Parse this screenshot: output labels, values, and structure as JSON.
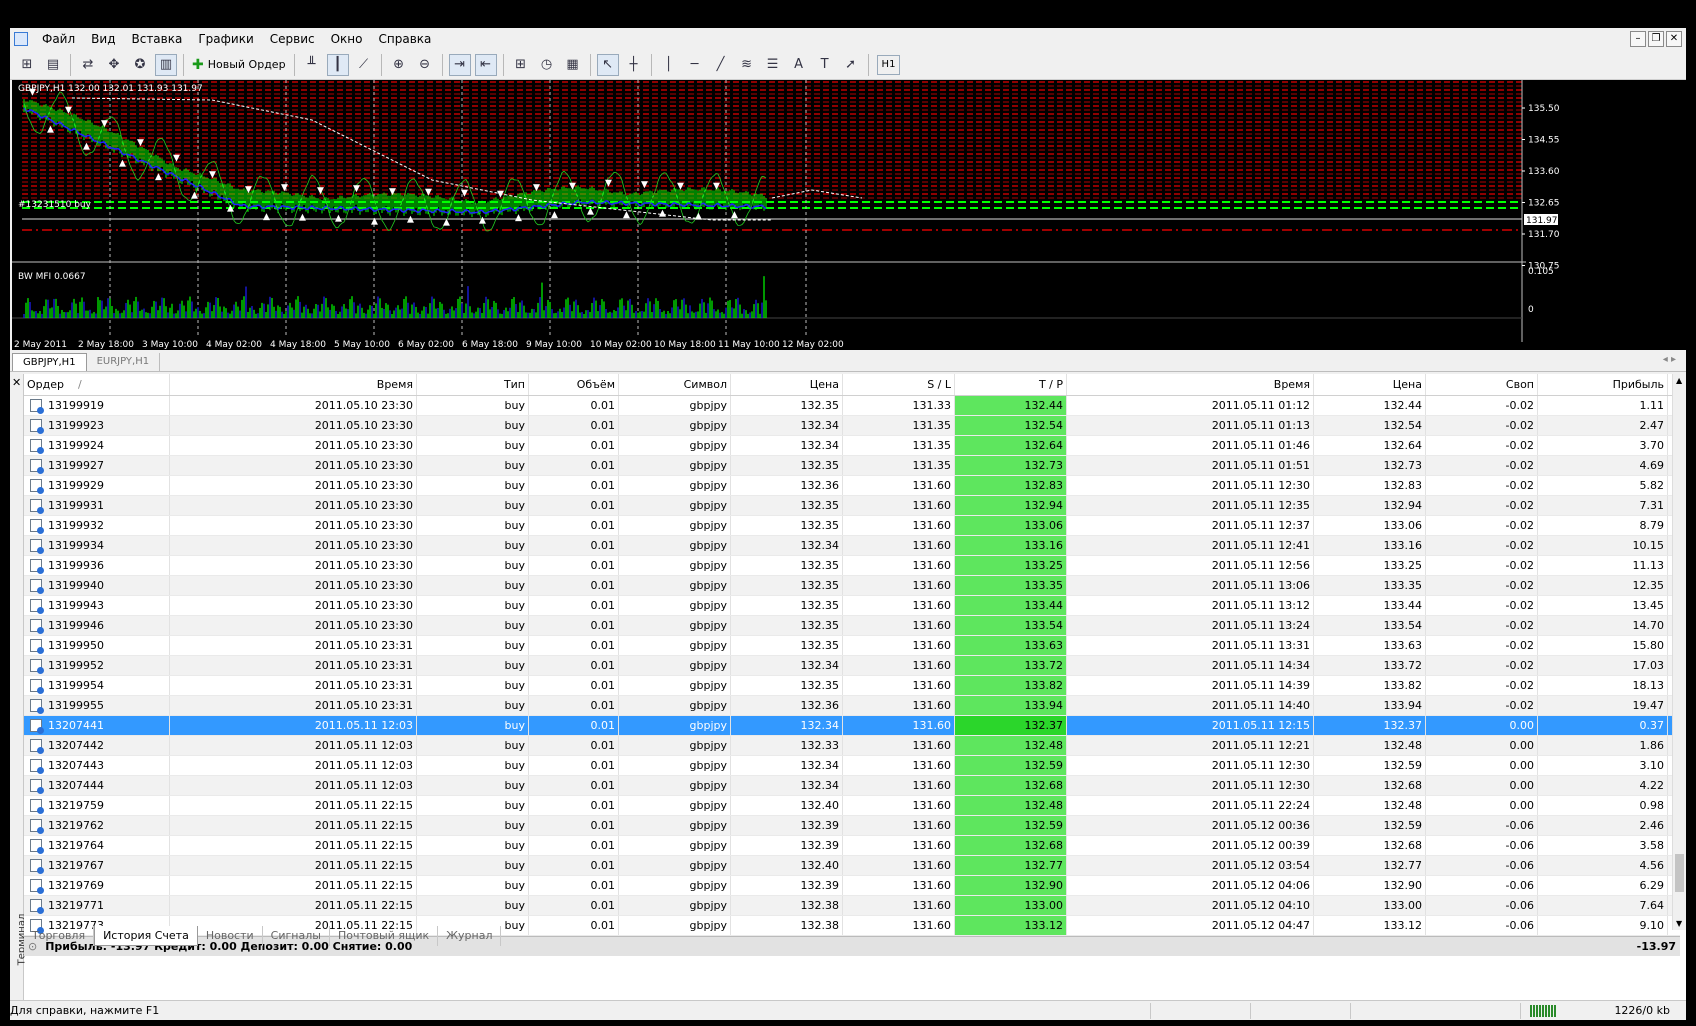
{
  "menu": [
    "Файл",
    "Вид",
    "Вставка",
    "Графики",
    "Сервис",
    "Окно",
    "Справка"
  ],
  "toolbar": {
    "new_order_label": "Новый Ордер",
    "timeframe": "H1"
  },
  "chart": {
    "symbol_info": "GBPJPY,H1  132.00 132.01 131.93 131.97",
    "order_label": "#13231510 buy",
    "current_price": "131.97",
    "price_ticks": [
      "135.50",
      "134.55",
      "133.60",
      "132.65",
      "131.70",
      "130.75"
    ],
    "indicator_label": "BW MFI 0.0667",
    "indicator_ticks": [
      "0.105",
      "0"
    ],
    "time_labels": [
      "2 May 2011",
      "2 May 18:00",
      "3 May 10:00",
      "4 May 02:00",
      "4 May 18:00",
      "5 May 10:00",
      "6 May 02:00",
      "6 May 18:00",
      "9 May 10:00",
      "10 May 02:00",
      "10 May 18:00",
      "11 May 10:00",
      "12 May 02:00"
    ],
    "colors": {
      "bg": "#000000",
      "up": "#00ff00",
      "grid": "#ff0000",
      "ma": "#2020ff",
      "trend": "#ffffff"
    }
  },
  "chart_tabs": [
    "GBPJPY,H1",
    "EURJPY,H1"
  ],
  "table": {
    "headers": {
      "order": "Ордер",
      "time": "Время",
      "type": "Тип",
      "volume": "Объём",
      "symbol": "Символ",
      "price": "Цена",
      "sl": "S / L",
      "tp": "T / P",
      "close_time": "Время",
      "close_price": "Цена",
      "swap": "Своп",
      "profit": "Прибыль"
    },
    "sort_mark": "/",
    "rows": [
      [
        "13199919",
        "2011.05.10 23:30",
        "buy",
        "0.01",
        "gbpjpy",
        "132.35",
        "131.33",
        "132.44",
        "2011.05.11 01:12",
        "132.44",
        "-0.02",
        "1.11"
      ],
      [
        "13199923",
        "2011.05.10 23:30",
        "buy",
        "0.01",
        "gbpjpy",
        "132.34",
        "131.35",
        "132.54",
        "2011.05.11 01:13",
        "132.54",
        "-0.02",
        "2.47"
      ],
      [
        "13199924",
        "2011.05.10 23:30",
        "buy",
        "0.01",
        "gbpjpy",
        "132.34",
        "131.35",
        "132.64",
        "2011.05.11 01:46",
        "132.64",
        "-0.02",
        "3.70"
      ],
      [
        "13199927",
        "2011.05.10 23:30",
        "buy",
        "0.01",
        "gbpjpy",
        "132.35",
        "131.35",
        "132.73",
        "2011.05.11 01:51",
        "132.73",
        "-0.02",
        "4.69"
      ],
      [
        "13199929",
        "2011.05.10 23:30",
        "buy",
        "0.01",
        "gbpjpy",
        "132.36",
        "131.60",
        "132.83",
        "2011.05.11 12:30",
        "132.83",
        "-0.02",
        "5.82"
      ],
      [
        "13199931",
        "2011.05.10 23:30",
        "buy",
        "0.01",
        "gbpjpy",
        "132.35",
        "131.60",
        "132.94",
        "2011.05.11 12:35",
        "132.94",
        "-0.02",
        "7.31"
      ],
      [
        "13199932",
        "2011.05.10 23:30",
        "buy",
        "0.01",
        "gbpjpy",
        "132.35",
        "131.60",
        "133.06",
        "2011.05.11 12:37",
        "133.06",
        "-0.02",
        "8.79"
      ],
      [
        "13199934",
        "2011.05.10 23:30",
        "buy",
        "0.01",
        "gbpjpy",
        "132.34",
        "131.60",
        "133.16",
        "2011.05.11 12:41",
        "133.16",
        "-0.02",
        "10.15"
      ],
      [
        "13199936",
        "2011.05.10 23:30",
        "buy",
        "0.01",
        "gbpjpy",
        "132.35",
        "131.60",
        "133.25",
        "2011.05.11 12:56",
        "133.25",
        "-0.02",
        "11.13"
      ],
      [
        "13199940",
        "2011.05.10 23:30",
        "buy",
        "0.01",
        "gbpjpy",
        "132.35",
        "131.60",
        "133.35",
        "2011.05.11 13:06",
        "133.35",
        "-0.02",
        "12.35"
      ],
      [
        "13199943",
        "2011.05.10 23:30",
        "buy",
        "0.01",
        "gbpjpy",
        "132.35",
        "131.60",
        "133.44",
        "2011.05.11 13:12",
        "133.44",
        "-0.02",
        "13.45"
      ],
      [
        "13199946",
        "2011.05.10 23:30",
        "buy",
        "0.01",
        "gbpjpy",
        "132.35",
        "131.60",
        "133.54",
        "2011.05.11 13:24",
        "133.54",
        "-0.02",
        "14.70"
      ],
      [
        "13199950",
        "2011.05.10 23:31",
        "buy",
        "0.01",
        "gbpjpy",
        "132.35",
        "131.60",
        "133.63",
        "2011.05.11 13:31",
        "133.63",
        "-0.02",
        "15.80"
      ],
      [
        "13199952",
        "2011.05.10 23:31",
        "buy",
        "0.01",
        "gbpjpy",
        "132.34",
        "131.60",
        "133.72",
        "2011.05.11 14:34",
        "133.72",
        "-0.02",
        "17.03"
      ],
      [
        "13199954",
        "2011.05.10 23:31",
        "buy",
        "0.01",
        "gbpjpy",
        "132.35",
        "131.60",
        "133.82",
        "2011.05.11 14:39",
        "133.82",
        "-0.02",
        "18.13"
      ],
      [
        "13199955",
        "2011.05.10 23:31",
        "buy",
        "0.01",
        "gbpjpy",
        "132.36",
        "131.60",
        "133.94",
        "2011.05.11 14:40",
        "133.94",
        "-0.02",
        "19.47"
      ],
      [
        "13207441",
        "2011.05.11 12:03",
        "buy",
        "0.01",
        "gbpjpy",
        "132.34",
        "131.60",
        "132.37",
        "2011.05.11 12:15",
        "132.37",
        "0.00",
        "0.37"
      ],
      [
        "13207442",
        "2011.05.11 12:03",
        "buy",
        "0.01",
        "gbpjpy",
        "132.33",
        "131.60",
        "132.48",
        "2011.05.11 12:21",
        "132.48",
        "0.00",
        "1.86"
      ],
      [
        "13207443",
        "2011.05.11 12:03",
        "buy",
        "0.01",
        "gbpjpy",
        "132.34",
        "131.60",
        "132.59",
        "2011.05.11 12:30",
        "132.59",
        "0.00",
        "3.10"
      ],
      [
        "13207444",
        "2011.05.11 12:03",
        "buy",
        "0.01",
        "gbpjpy",
        "132.34",
        "131.60",
        "132.68",
        "2011.05.11 12:30",
        "132.68",
        "0.00",
        "4.22"
      ],
      [
        "13219759",
        "2011.05.11 22:15",
        "buy",
        "0.01",
        "gbpjpy",
        "132.40",
        "131.60",
        "132.48",
        "2011.05.11 22:24",
        "132.48",
        "0.00",
        "0.98"
      ],
      [
        "13219762",
        "2011.05.11 22:15",
        "buy",
        "0.01",
        "gbpjpy",
        "132.39",
        "131.60",
        "132.59",
        "2011.05.12 00:36",
        "132.59",
        "-0.06",
        "2.46"
      ],
      [
        "13219764",
        "2011.05.11 22:15",
        "buy",
        "0.01",
        "gbpjpy",
        "132.39",
        "131.60",
        "132.68",
        "2011.05.12 00:39",
        "132.68",
        "-0.06",
        "3.58"
      ],
      [
        "13219767",
        "2011.05.11 22:15",
        "buy",
        "0.01",
        "gbpjpy",
        "132.40",
        "131.60",
        "132.77",
        "2011.05.12 03:54",
        "132.77",
        "-0.06",
        "4.56"
      ],
      [
        "13219769",
        "2011.05.11 22:15",
        "buy",
        "0.01",
        "gbpjpy",
        "132.39",
        "131.60",
        "132.90",
        "2011.05.12 04:06",
        "132.90",
        "-0.06",
        "6.29"
      ],
      [
        "13219771",
        "2011.05.11 22:15",
        "buy",
        "0.01",
        "gbpjpy",
        "132.38",
        "131.60",
        "133.00",
        "2011.05.12 04:10",
        "133.00",
        "-0.06",
        "7.64"
      ],
      [
        "13219773",
        "2011.05.11 22:15",
        "buy",
        "0.01",
        "gbpjpy",
        "132.38",
        "131.60",
        "133.12",
        "2011.05.12 04:47",
        "133.12",
        "-0.06",
        "9.10"
      ]
    ],
    "selected_row_index": 16,
    "summary": "Прибыль: -13.97  Кредит: 0.00  Депозит: 0.00  Снятие: 0.00",
    "summary_total": "-13.97"
  },
  "terminal_label": "Терминал",
  "bottom_tabs": [
    "Торговля",
    "История Счета",
    "Новости",
    "Сигналы",
    "Почтовый ящик",
    "Журнал"
  ],
  "bottom_tab_selected": 1,
  "status": {
    "help": "Для справки, нажмите F1",
    "size": "1226/0 kb"
  }
}
